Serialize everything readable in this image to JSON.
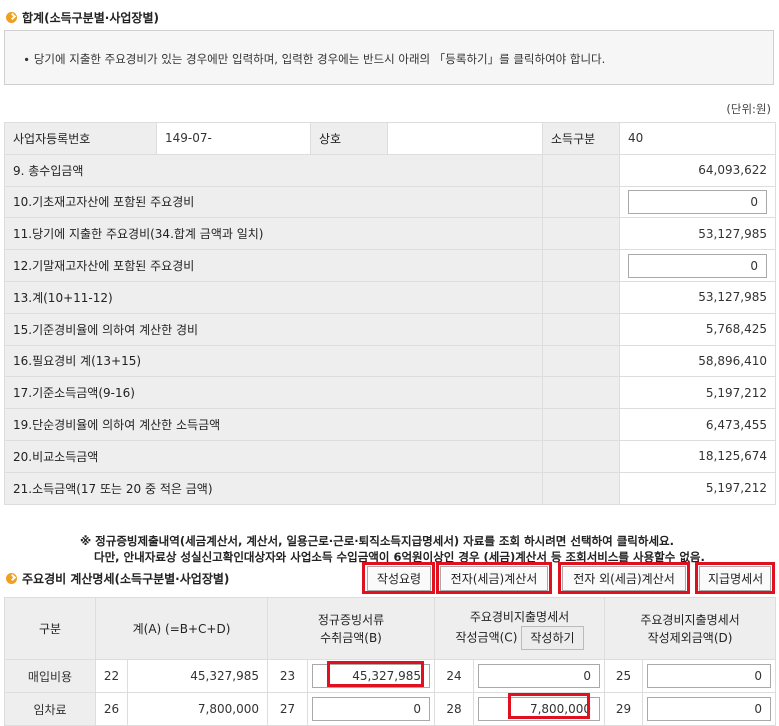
{
  "summary": {
    "title": "합계(소득구분별·사업장별)",
    "notice": "∙ 당기에 지출한 주요경비가 있는 경우에만 입력하며, 입력한 경우에는 반드시 아래의 「등록하기」를 클릭하여야 합니다.",
    "unit": "(단위:원)",
    "header": {
      "bizno_label": "사업자등록번호",
      "bizno_value": "149-07-",
      "name_label": "상호",
      "name_value": "",
      "income_label": "소득구분",
      "income_value": "40"
    },
    "rows": [
      {
        "label": "9. 총수입금액",
        "value": "64,093,622"
      },
      {
        "label": "10.기초재고자산에 포함된 주요경비",
        "value": "0"
      },
      {
        "label": "11.당기에 지출한 주요경비(34.합계 금액과 일치)",
        "value": "53,127,985"
      },
      {
        "label": "12.기말재고자산에 포함된 주요경비",
        "value": "0"
      },
      {
        "label": "13.계(10+11-12)",
        "value": "53,127,985"
      },
      {
        "label": "15.기준경비율에 의하여 계산한 경비",
        "value": "5,768,425"
      },
      {
        "label": "16.필요경비 계(13+15)",
        "value": "58,896,410"
      },
      {
        "label": "17.기준소득금액(9-16)",
        "value": "5,197,212"
      },
      {
        "label": "19.단순경비율에 의하여 계산한 소득금액",
        "value": "6,473,455"
      },
      {
        "label": "20.비교소득금액",
        "value": "18,125,674"
      },
      {
        "label": "21.소득금액(17 또는 20 중 적은 금액)",
        "value": "5,197,212"
      }
    ]
  },
  "notes": {
    "line1": "※ 정규증빙제출내역(세금계산서, 계산서, 일용근로·근로·퇴직소득지급명세서) 자료를 조회 하시려면 선택하여 클릭하세요.",
    "line2": "다만, 안내자료상 성실신고확인대상자와 사업소득 수입금액이 6억원이상인 경우 (세금)계산서 등 조회서비스를 사용할수 없음."
  },
  "detail": {
    "title": "주요경비 계산명세(소득구분별·사업장별)",
    "buttons": {
      "guide": "작성요령",
      "etax": "전자(세금)계산서",
      "non_etax": "전자 외(세금)계산서",
      "payment": "지급명세서"
    },
    "headers": {
      "category": "구분",
      "total": "계(A) (=B+C+D)",
      "proof_l1": "정규증빙서류",
      "proof_l2": "수취금액(B)",
      "stmt_l1": "주요경비지출명세서",
      "stmt_l2": "작성금액(C)",
      "write_button": "작성하기",
      "excl_l1": "주요경비지출명세서",
      "excl_l2": "작성제외금액(D)"
    },
    "rows": [
      {
        "label": "매입비용",
        "no_a": "22",
        "total": "45,327,985",
        "no_b": "23",
        "b": "45,327,985",
        "no_c": "24",
        "c": "0",
        "no_d": "25",
        "d": "0"
      },
      {
        "label": "임차료",
        "no_a": "26",
        "total": "7,800,000",
        "no_b": "27",
        "b": "0",
        "no_c": "28",
        "c": "7,800,000",
        "no_d": "29",
        "d": "0"
      }
    ]
  },
  "colors": {
    "highlight": "#e0101e",
    "label_bg": "#eeeeee",
    "bullet": "#f0a020"
  }
}
